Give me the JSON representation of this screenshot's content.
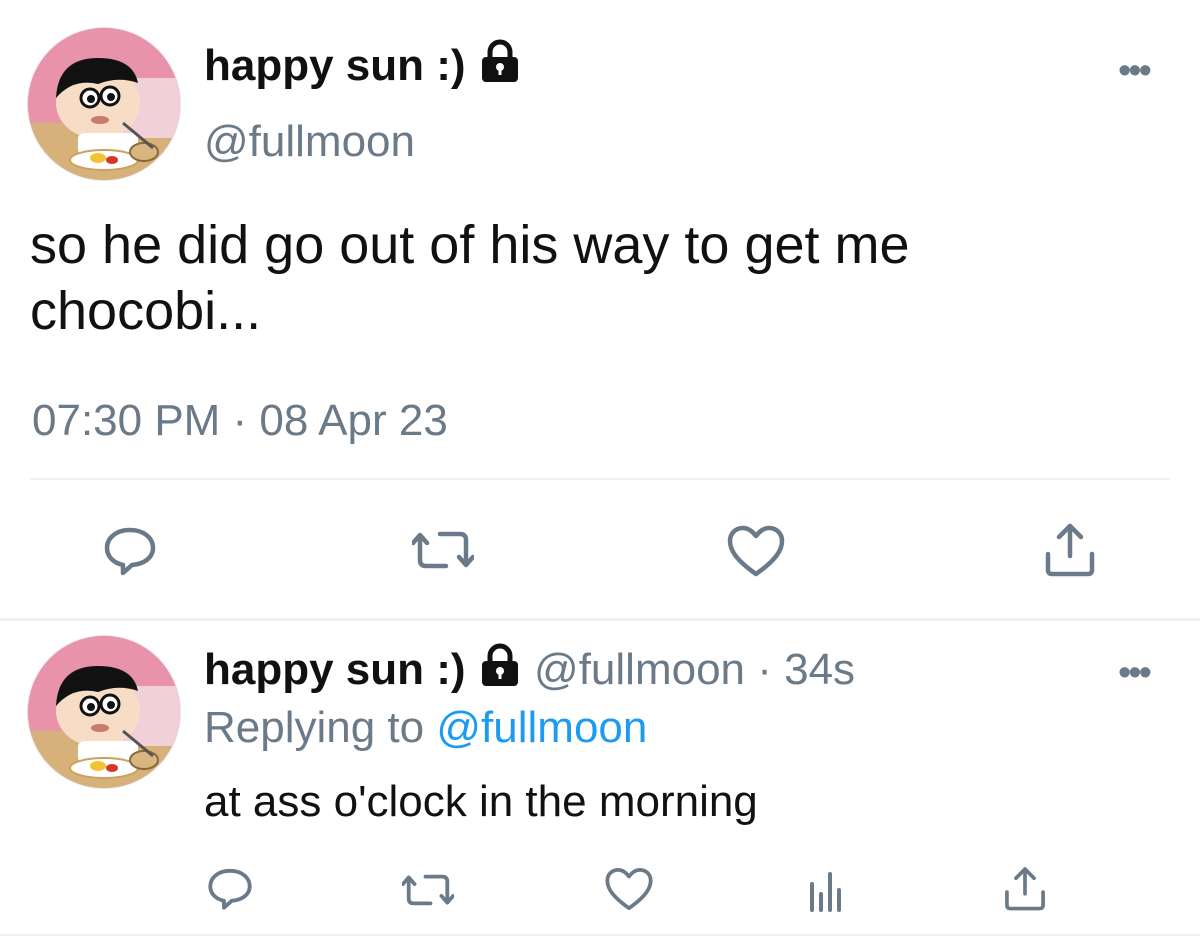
{
  "main_tweet": {
    "display_name": "happy sun :)",
    "handle": "@fullmoon",
    "text_line1": "so he did go out of his way to get me",
    "text_line2": "chocobi...",
    "timestamp": "07:30 PM · 08 Apr 23",
    "avatar_icon": "cartoon-boy-avatar",
    "lock_icon": "lock-icon",
    "more_icon": "more-options-icon",
    "actions": [
      "reply-icon",
      "retweet-icon",
      "like-icon",
      "share-icon"
    ]
  },
  "reply_tweet": {
    "display_name": "happy sun :)",
    "handle_time": "@fullmoon · 34s",
    "replying_prefix": "Replying to",
    "replying_handle": "@fullmoon",
    "text": "at ass o'clock in the morning",
    "avatar_icon": "cartoon-boy-avatar",
    "lock_icon": "lock-icon",
    "more_icon": "more-options-icon",
    "actions": [
      "reply-icon",
      "retweet-icon",
      "like-icon",
      "analytics-icon",
      "share-icon"
    ]
  },
  "colors": {
    "text": "#0f1419",
    "muted": "#6b7a88",
    "link": "#1d9bf0",
    "divider": "#eef0f2"
  }
}
